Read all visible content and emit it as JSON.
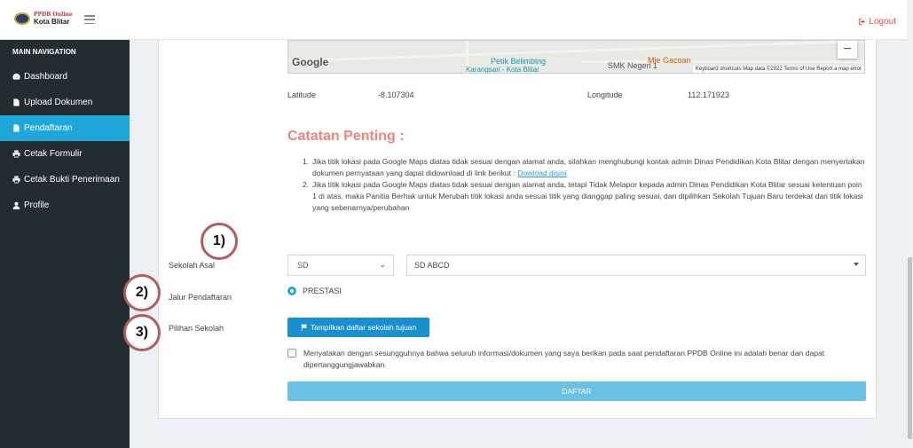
{
  "header": {
    "logo_line1": "PPDB Online",
    "logo_line2": "Kota Blitar",
    "logout_label": "Logout"
  },
  "sidebar": {
    "heading": "MAIN NAVIGATION",
    "items": [
      {
        "label": "Dashboard",
        "icon": "dashboard-icon"
      },
      {
        "label": "Upload Dokumen",
        "icon": "file-icon"
      },
      {
        "label": "Pendaftaran",
        "icon": "file-icon",
        "active": true
      },
      {
        "label": "Cetak Formulir",
        "icon": "print-icon"
      },
      {
        "label": "Cetak Bukti Penerimaan",
        "icon": "print-icon"
      },
      {
        "label": "Profile",
        "icon": "user-icon"
      }
    ]
  },
  "map": {
    "google": "Google",
    "poi_1": "Mie Gacoan",
    "poi_2": "Petik Belimbing",
    "poi_2b": "Karangsari - Kota Blitar",
    "poi_3": "SMK Negeri 1",
    "attribution": "Keyboard shortcuts   Map data ©2022   Terms of Use   Report a map error",
    "zoom_out": "−"
  },
  "location": {
    "lat_label": "Latitude",
    "lat_value": "-8.107304",
    "lng_label": "Longitude",
    "lng_value": "112.171923"
  },
  "notes": {
    "title": "Catatan Penting :",
    "item1_num": "1.",
    "item1_text": "Jika titik lokasi pada Google Maps diatas tidak sesuai dengan alamat anda, silahkan menghubungi kontak admin Dinas Pendidikan Kota Blitar dengan menyertakan dokumen pernyataan yang dapat didownload di link berikut : ",
    "item1_link": "Dowload disini",
    "item2_num": "2.",
    "item2_text": "Jika titik lokasi pada Google Maps diatas tidak sesuai dengan alamat anda, tetapi Tidak Melapor kepada admin Dinas Pendidikan Kota Blitar sesuai ketentuan poin 1 di atas, maka Panitia Berhak untuk Merubah titik lokasi anda sesuai titik yang dianggap paling sesuai, dan dipilihkan Sekolah Tujuan Baru terdekat dari titik lokasi yang sebenarnya/perubahan"
  },
  "form": {
    "sekolah_asal_label": "Sekolah Asal",
    "jenjang_value": "SD",
    "sekolah_value": "SD ABCD",
    "jalur_label": "Jalur Pendaftaran",
    "jalur_option": "PRESTASI",
    "pilihan_label": "Pilihan Sekolah",
    "show_button": "Tampilkan daftar sekolah tujuan",
    "agreement_text": "Menyatakan dengan sesungguhnya bahwa seluruh informasi/dokumen yang saya berikan pada saat pendaftaran PPDB Online ini adalah benar dan dapat dipertanggungjawabkan.",
    "submit_button": "DAFTAR"
  },
  "markers": [
    "1)",
    "2)",
    "3)"
  ],
  "colors": {
    "sidebar_bg": "#222d32",
    "active_item": "#1fa7dc",
    "title_red": "#f0837a",
    "button_blue": "#1a8fce",
    "daftar_blue": "#6bc1e3"
  }
}
